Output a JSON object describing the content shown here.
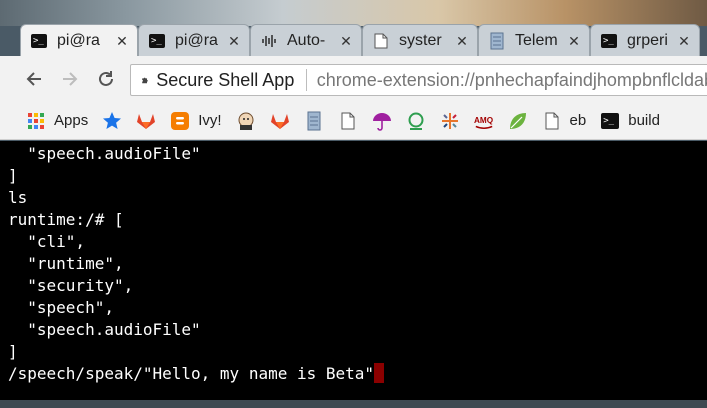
{
  "tabs": [
    {
      "title": "pi@ra",
      "icon": "terminal-icon",
      "active": true
    },
    {
      "title": "pi@ra",
      "icon": "terminal-icon",
      "active": false
    },
    {
      "title": "Auto-",
      "icon": "waveform-icon",
      "active": false
    },
    {
      "title": "syster",
      "icon": "document-icon",
      "active": false
    },
    {
      "title": "Telem",
      "icon": "server-icon",
      "active": false
    },
    {
      "title": "grperi",
      "icon": "terminal-icon",
      "active": false
    }
  ],
  "close_glyph": "✕",
  "omnibox": {
    "app_name": "Secure Shell App",
    "url": "chrome-extension://pnhechapfaindjhompbnflcldab"
  },
  "bookmarks": [
    {
      "label": "Apps",
      "icon": "apps-grid-icon"
    },
    {
      "label": "",
      "icon": "star-icon"
    },
    {
      "label": "",
      "icon": "gitlab-icon"
    },
    {
      "label": "Ivy!",
      "icon": "blogger-icon"
    },
    {
      "label": "",
      "icon": "jenkins-icon"
    },
    {
      "label": "",
      "icon": "gitlab-icon"
    },
    {
      "label": "",
      "icon": "server-icon"
    },
    {
      "label": "",
      "icon": "document-icon"
    },
    {
      "label": "",
      "icon": "umbrella-icon"
    },
    {
      "label": "",
      "icon": "ring-icon"
    },
    {
      "label": "",
      "icon": "tableau-icon"
    },
    {
      "label": "AMQ",
      "icon": "amq-icon"
    },
    {
      "label": "",
      "icon": "leaf-icon"
    },
    {
      "label": "eb",
      "icon": "document-icon"
    },
    {
      "label": "build",
      "icon": "terminal-icon"
    }
  ],
  "terminal": {
    "lines": [
      "  \"speech.audioFile\"",
      "]",
      "ls",
      "runtime:/# [",
      "  \"cli\",",
      "  \"runtime\",",
      "  \"security\",",
      "  \"speech\",",
      "  \"speech.audioFile\"",
      "]"
    ],
    "input_line": "/speech/speak/\"Hello, my name is Beta\""
  },
  "colors": {
    "cursor": "#8b0000",
    "terminal_bg": "#000000",
    "terminal_fg": "#ffffff"
  }
}
